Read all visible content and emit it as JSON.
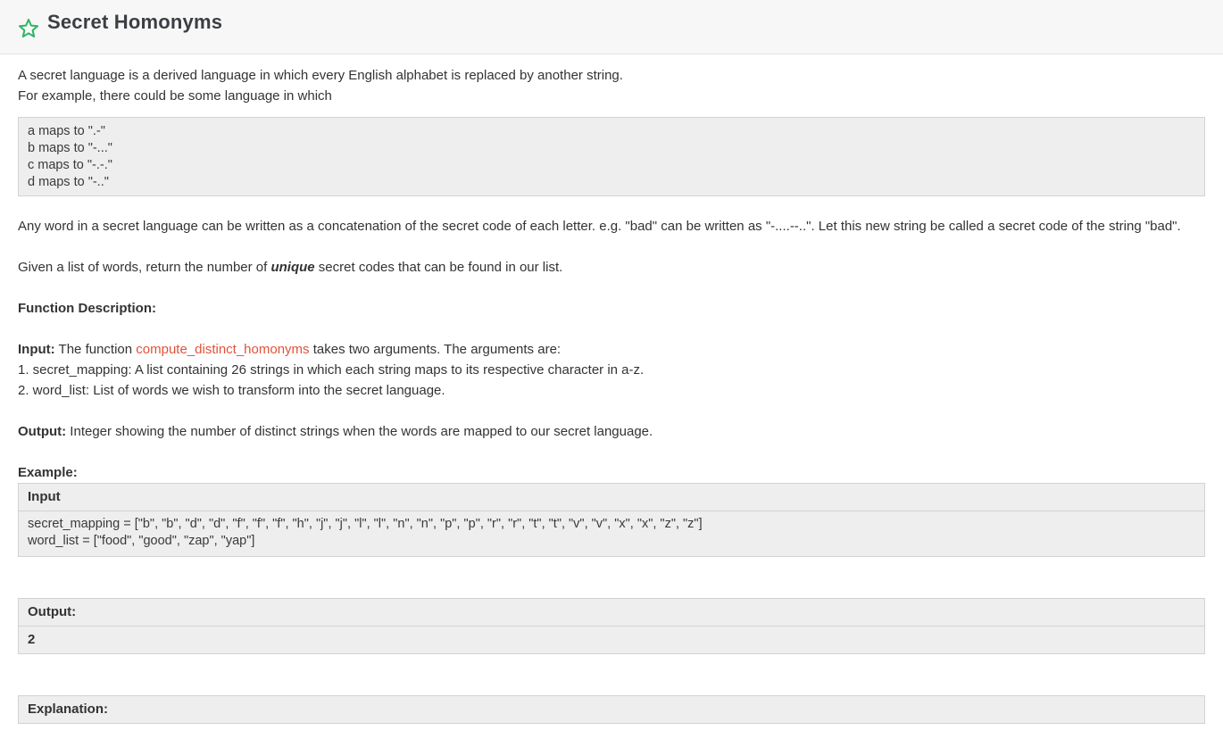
{
  "header": {
    "title": "Secret Homonyms",
    "star_color": "#2db564"
  },
  "intro": {
    "line1": "A secret language is a derived language in which every English alphabet is replaced by another string.",
    "line2": "For example, there could be some language in which"
  },
  "mapping_example": [
    "a maps to \".-\"",
    "b maps to \"-...\"",
    "c maps to \"-.-.\"",
    "d maps to \"-..\""
  ],
  "paragraph2": "Any word in a secret language can be written as a concatenation of the secret code of each letter. e.g. \"bad\" can be written as \"-....--..\". Let this new string be called a secret code of the string \"bad\".",
  "paragraph3": {
    "before": "Given a list of words, return the number of ",
    "emphasis": "unique",
    "after": " secret codes that can be found in our list."
  },
  "function_description_label": "Function Description:",
  "input_section": {
    "label": "Input:",
    "text_before": " The function ",
    "function_name": "compute_distinct_homonyms",
    "text_after": " takes two arguments. The arguments are:",
    "arg1": "1. secret_mapping: A list containing 26 strings in which each string maps to its respective character in a-z.",
    "arg2": "2. word_list: List of words we wish to transform into the secret language."
  },
  "output_section": {
    "label": "Output:",
    "text": " Integer showing the number of distinct strings when the words are mapped to our secret language."
  },
  "example": {
    "label": "Example:",
    "input_header": "Input",
    "input_lines": [
      "secret_mapping = [\"b\", \"b\", \"d\", \"d\", \"f\", \"f\", \"f\", \"h\", \"j\", \"j\", \"l\", \"l\", \"n\", \"n\", \"p\", \"p\", \"r\", \"r\", \"t\", \"t\", \"v\", \"v\", \"x\", \"x\", \"z\", \"z\"]",
      "word_list = [\"food\", \"good\", \"zap\", \"yap\"]"
    ],
    "output_header": "Output:",
    "output_value": "2",
    "explanation_header": "Explanation:"
  },
  "colors": {
    "link": "#e0533a",
    "box_bg": "#eeeeee",
    "header_bg": "#f7f7f7"
  }
}
